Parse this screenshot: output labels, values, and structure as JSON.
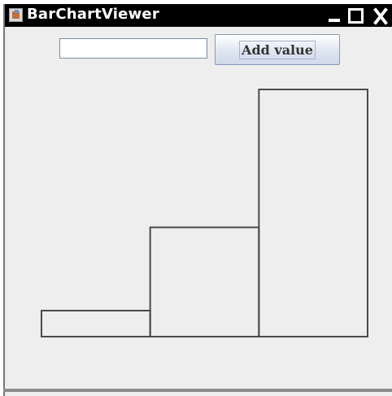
{
  "window": {
    "title": "BarChartViewer",
    "controls": [
      "minimize-icon",
      "maximize-icon",
      "close-icon"
    ]
  },
  "input": {
    "value": "",
    "placeholder": ""
  },
  "add_button": {
    "label": "Add value"
  },
  "chart_data": {
    "type": "bar",
    "values": [
      10,
      42,
      95
    ],
    "ylim": [
      0,
      100
    ],
    "bar_fill": "none",
    "bar_stroke": "#4a4a4a"
  }
}
